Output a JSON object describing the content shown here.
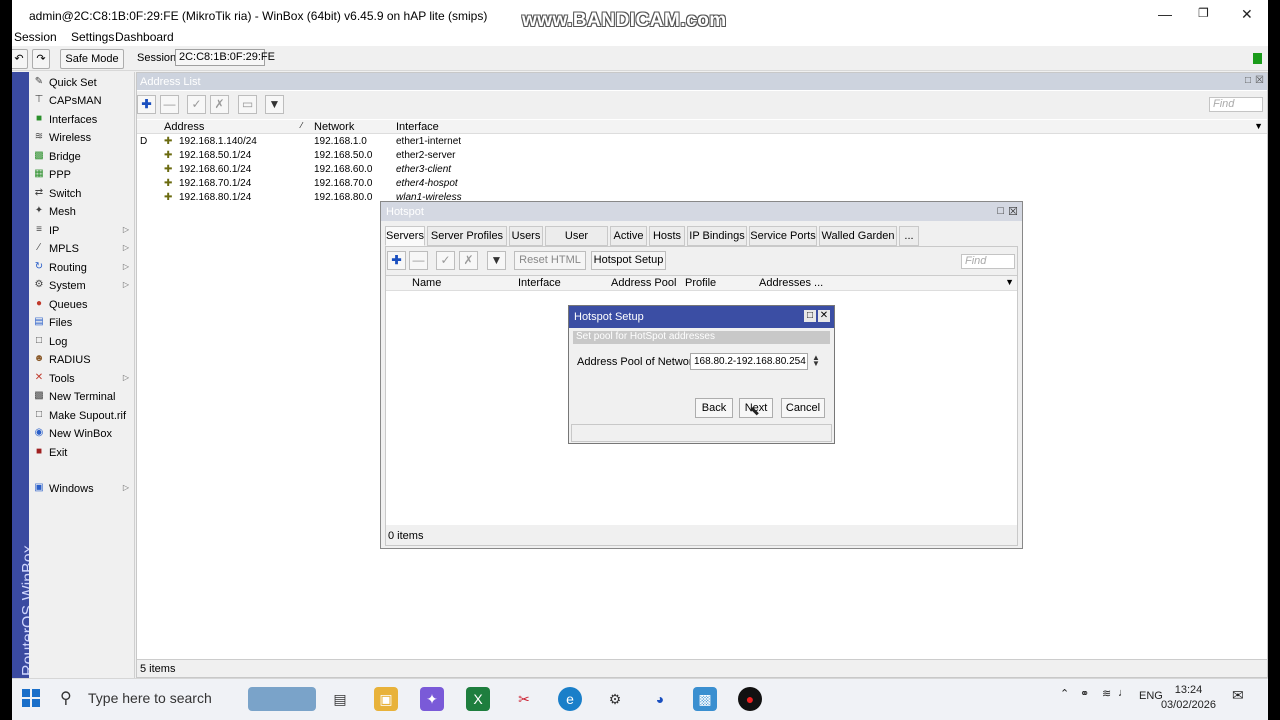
{
  "window": {
    "title": "admin@2C:C8:1B:0F:29:FE (MikroTik ria) - WinBox (64bit) v6.45.9 on hAP lite (smips)",
    "watermark": "www.BANDICAM.com"
  },
  "menu": [
    "Session",
    "Settings",
    "Dashboard"
  ],
  "toolbar": {
    "safe_mode": "Safe Mode",
    "session_label": "Session:",
    "session_value": "2C:C8:1B:0F:29:FE"
  },
  "rail_text": "RouterOS WinBox",
  "sidebar": [
    {
      "label": "Quick Set",
      "icon": "quick-set-icon",
      "sub": false
    },
    {
      "label": "CAPsMAN",
      "icon": "capsman-icon",
      "sub": false
    },
    {
      "label": "Interfaces",
      "icon": "interfaces-icon",
      "sub": false
    },
    {
      "label": "Wireless",
      "icon": "wireless-icon",
      "sub": false
    },
    {
      "label": "Bridge",
      "icon": "bridge-icon",
      "sub": false
    },
    {
      "label": "PPP",
      "icon": "ppp-icon",
      "sub": false
    },
    {
      "label": "Switch",
      "icon": "switch-icon",
      "sub": false
    },
    {
      "label": "Mesh",
      "icon": "mesh-icon",
      "sub": false
    },
    {
      "label": "IP",
      "icon": "ip-icon",
      "sub": true
    },
    {
      "label": "MPLS",
      "icon": "mpls-icon",
      "sub": true
    },
    {
      "label": "Routing",
      "icon": "routing-icon",
      "sub": true
    },
    {
      "label": "System",
      "icon": "system-icon",
      "sub": true
    },
    {
      "label": "Queues",
      "icon": "queues-icon",
      "sub": false
    },
    {
      "label": "Files",
      "icon": "files-icon",
      "sub": false
    },
    {
      "label": "Log",
      "icon": "log-icon",
      "sub": false
    },
    {
      "label": "RADIUS",
      "icon": "radius-icon",
      "sub": false
    },
    {
      "label": "Tools",
      "icon": "tools-icon",
      "sub": true
    },
    {
      "label": "New Terminal",
      "icon": "terminal-icon",
      "sub": false
    },
    {
      "label": "Make Supout.rif",
      "icon": "supout-icon",
      "sub": false
    },
    {
      "label": "New WinBox",
      "icon": "winbox-icon",
      "sub": false
    },
    {
      "label": "Exit",
      "icon": "exit-icon",
      "sub": false
    },
    {
      "label": "Windows",
      "icon": "windows-icon",
      "sub": true
    }
  ],
  "address_list": {
    "title": "Address List",
    "find": "Find",
    "columns": [
      "Address",
      "Network",
      "Interface"
    ],
    "rows": [
      {
        "flag": "D",
        "address": "192.168.1.140/24",
        "network": "192.168.1.0",
        "interface": "ether1-internet"
      },
      {
        "flag": "",
        "address": "192.168.50.1/24",
        "network": "192.168.50.0",
        "interface": "ether2-server"
      },
      {
        "flag": "",
        "address": "192.168.60.1/24",
        "network": "192.168.60.0",
        "interface": "ether3-client"
      },
      {
        "flag": "",
        "address": "192.168.70.1/24",
        "network": "192.168.70.0",
        "interface": "ether4-hospot"
      },
      {
        "flag": "",
        "address": "192.168.80.1/24",
        "network": "192.168.80.0",
        "interface": "wlan1-wireless"
      }
    ],
    "status": "5 items"
  },
  "hotspot": {
    "title": "Hotspot",
    "tabs": [
      "Servers",
      "Server Profiles",
      "Users",
      "User Profiles",
      "Active",
      "Hosts",
      "IP Bindings",
      "Service Ports",
      "Walled Garden",
      "..."
    ],
    "reset_html": "Reset HTML",
    "hotspot_setup": "Hotspot Setup",
    "find": "Find",
    "columns": [
      "Name",
      "Interface",
      "Address Pool",
      "Profile",
      "Addresses ..."
    ],
    "status": "0 items"
  },
  "setup": {
    "title": "Hotspot Setup",
    "subtitle": "Set pool for HotSpot addresses",
    "field_label": "Address Pool of Network:",
    "field_value": "168.80.2-192.168.80.254",
    "back": "Back",
    "next": "Next",
    "cancel": "Cancel"
  },
  "taskbar": {
    "search_placeholder": "Type here to search",
    "lang": "ENG",
    "time": "13:24",
    "date": "03/02/2026"
  }
}
